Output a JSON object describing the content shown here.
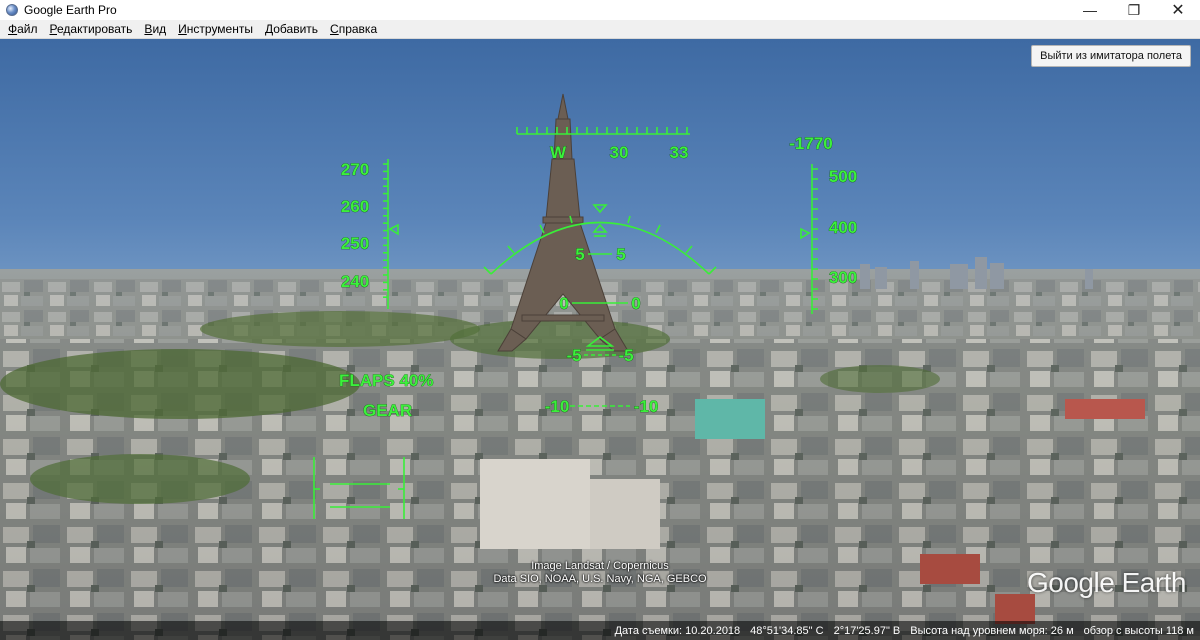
{
  "window": {
    "title": "Google Earth Pro",
    "controls": {
      "minimize": "—",
      "maximize": "❐",
      "close": "✕"
    }
  },
  "menu": [
    {
      "label": "Файл"
    },
    {
      "label": "Редактировать"
    },
    {
      "label": "Вид"
    },
    {
      "label": "Инструменты"
    },
    {
      "label": "Добавить"
    },
    {
      "label": "Справка"
    }
  ],
  "viewer": {
    "exit_button": "Выйти из имитатора полета",
    "attribution_line1": "Image Landsat / Copernicus",
    "attribution_line2": "Data SIO, NOAA, U.S. Navy, NGA, GEBCO",
    "watermark": "Google Earth"
  },
  "hud": {
    "heading_labels": [
      "W",
      "30",
      "33"
    ],
    "speed_labels": [
      "270",
      "260",
      "250",
      "240"
    ],
    "altitude_labels": [
      "500",
      "400",
      "300"
    ],
    "vertical_speed": "-1770",
    "pitch_left": [
      "5",
      "0",
      "-5",
      "-10"
    ],
    "pitch_right": [
      "5",
      "0",
      "-5",
      "-10"
    ],
    "flaps": "FLAPS 40%",
    "gear": "GEAR",
    "color": "#3cf03c"
  },
  "status": {
    "date": "Дата съемки: 10.20.2018",
    "latitude": "48°51'34.85\" С",
    "longitude": "2°17'25.97\" В",
    "elevation": "Высота над уровнем моря:   26 м",
    "eye_altitude": "обзор с высоты   118 м"
  }
}
